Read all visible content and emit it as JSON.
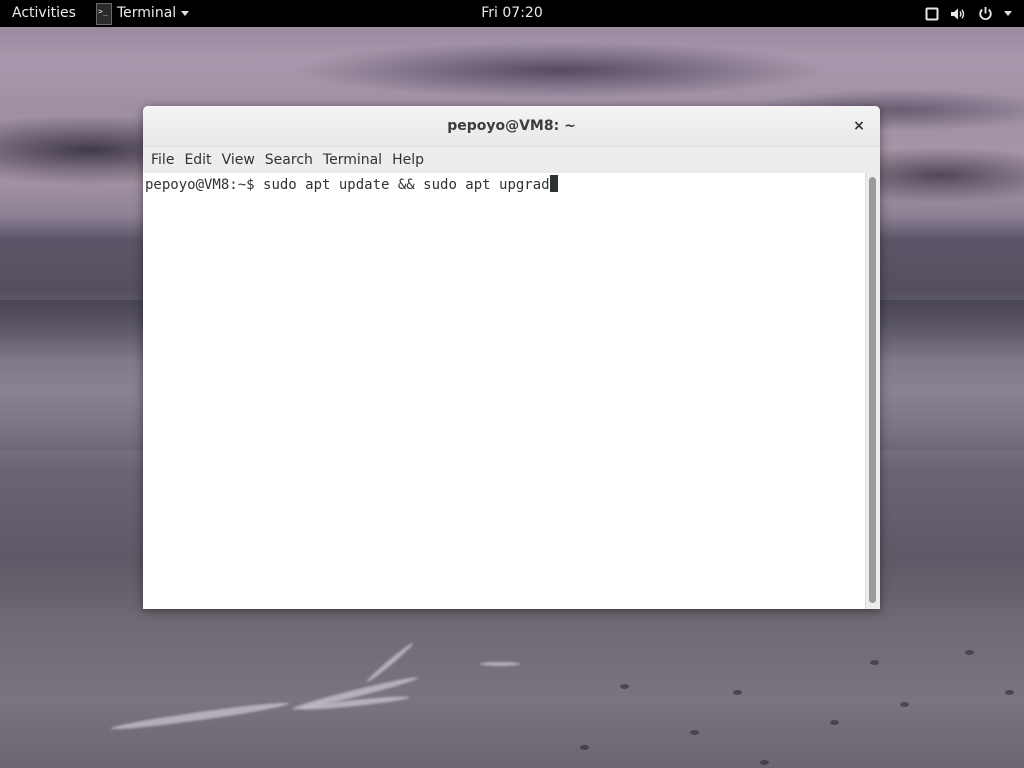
{
  "topbar": {
    "activities_label": "Activities",
    "app_name": "Terminal",
    "clock": "Fri 07:20",
    "tray_icons": [
      "screen-icon",
      "volume-icon",
      "power-icon",
      "chevron-down-icon"
    ]
  },
  "window": {
    "title": "pepoyo@VM8: ~",
    "close_glyph": "×",
    "menu": [
      "File",
      "Edit",
      "View",
      "Search",
      "Terminal",
      "Help"
    ]
  },
  "terminal": {
    "prompt": "pepoyo@VM8:~$ ",
    "command": "sudo apt update && sudo apt upgrad"
  },
  "colors": {
    "topbar_bg": "#000000",
    "terminal_bg": "#ffffff",
    "terminal_fg": "#2e3436"
  }
}
